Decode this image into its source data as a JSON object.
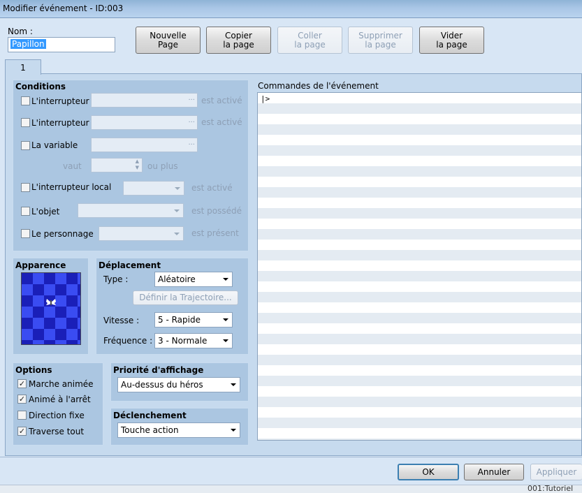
{
  "window": {
    "title": "Modifier événement - ID:003"
  },
  "name_field": {
    "label": "Nom :",
    "value": "Papillon"
  },
  "toolbar": {
    "new_l1": "Nouvelle",
    "new_l2": "Page",
    "copy_l1": "Copier",
    "copy_l2": "la page",
    "paste_l1": "Coller",
    "paste_l2": "la page",
    "delete_l1": "Supprimer",
    "delete_l2": "la page",
    "clear_l1": "Vider",
    "clear_l2": "la page"
  },
  "tab": {
    "label": "1"
  },
  "conditions": {
    "title": "Conditions",
    "switch1": {
      "label": "L'interrupteur",
      "suffix": "est activé",
      "ellipsis": "..."
    },
    "switch2": {
      "label": "L'interrupteur",
      "suffix": "est activé",
      "ellipsis": "..."
    },
    "variable": {
      "label": "La variable",
      "ellipsis": "...",
      "worth": "vaut",
      "or_more": "ou plus"
    },
    "self_switch": {
      "label": "L'interrupteur local",
      "suffix": "est activé"
    },
    "item": {
      "label": "L'objet",
      "suffix": "est possédé"
    },
    "actor": {
      "label": "Le personnage",
      "suffix": "est présent"
    }
  },
  "appearance": {
    "title": "Apparence"
  },
  "movement": {
    "title": "Déplacement",
    "type_label": "Type :",
    "type_value": "Aléatoire",
    "route_button": "Définir la Trajectoire...",
    "speed_label": "Vitesse :",
    "speed_value": "5 - Rapide",
    "freq_label": "Fréquence :",
    "freq_value": "3 - Normale"
  },
  "options": {
    "title": "Options",
    "walk": {
      "label": "Marche animée",
      "checked": true
    },
    "step": {
      "label": "Animé à l'arrêt",
      "checked": true
    },
    "dirfix": {
      "label": "Direction fixe",
      "checked": false
    },
    "through": {
      "label": "Traverse tout",
      "checked": true
    }
  },
  "priority": {
    "title": "Priorité d'affichage",
    "value": "Au-dessus du héros"
  },
  "trigger": {
    "title": "Déclenchement",
    "value": "Touche action"
  },
  "commands": {
    "title": "Commandes de l'événement",
    "first_line": "|>"
  },
  "footer": {
    "ok": "OK",
    "cancel": "Annuler",
    "apply": "Appliquer",
    "status": "001:Tutoriel"
  },
  "colors": {
    "panel": "#abc6e1",
    "window": "#d8e6f5",
    "tile_dark": "#1a1fb8",
    "tile_light": "#3a4cf2"
  }
}
